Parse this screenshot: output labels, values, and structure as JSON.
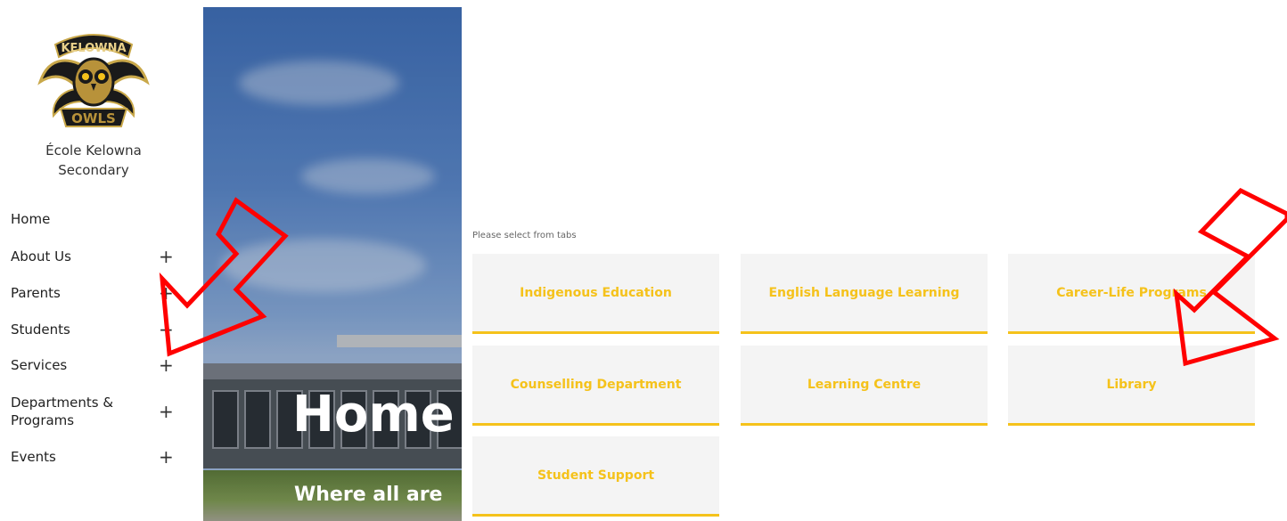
{
  "sidebar": {
    "school_name_line1": "École Kelowna",
    "school_name_line2": "Secondary",
    "logo": {
      "icon": "owl-crest-icon",
      "text": "KELOWNA",
      "sub": "OWLS"
    },
    "nav": [
      {
        "label": "Home",
        "expandable": false
      },
      {
        "label": "About Us",
        "expandable": true
      },
      {
        "label": "Parents",
        "expandable": true
      },
      {
        "label": "Students",
        "expandable": true
      },
      {
        "label": "Services",
        "expandable": true
      },
      {
        "label": "Departments &\nPrograms",
        "expandable": true
      },
      {
        "label": "Events",
        "expandable": true
      }
    ],
    "expand_glyph": "+"
  },
  "hero": {
    "title": "Home",
    "tagline": "Where all are"
  },
  "tabs": {
    "instruction": "Please select from tabs",
    "items": [
      "Indigenous Education",
      "English Language Learning",
      "Career-Life Programs",
      "Counselling Department",
      "Learning Centre",
      "Library",
      "Student Support"
    ]
  },
  "colors": {
    "accent": "#f5c21b",
    "tab_bg": "#f4f4f4",
    "arrow": "#ff0000"
  }
}
